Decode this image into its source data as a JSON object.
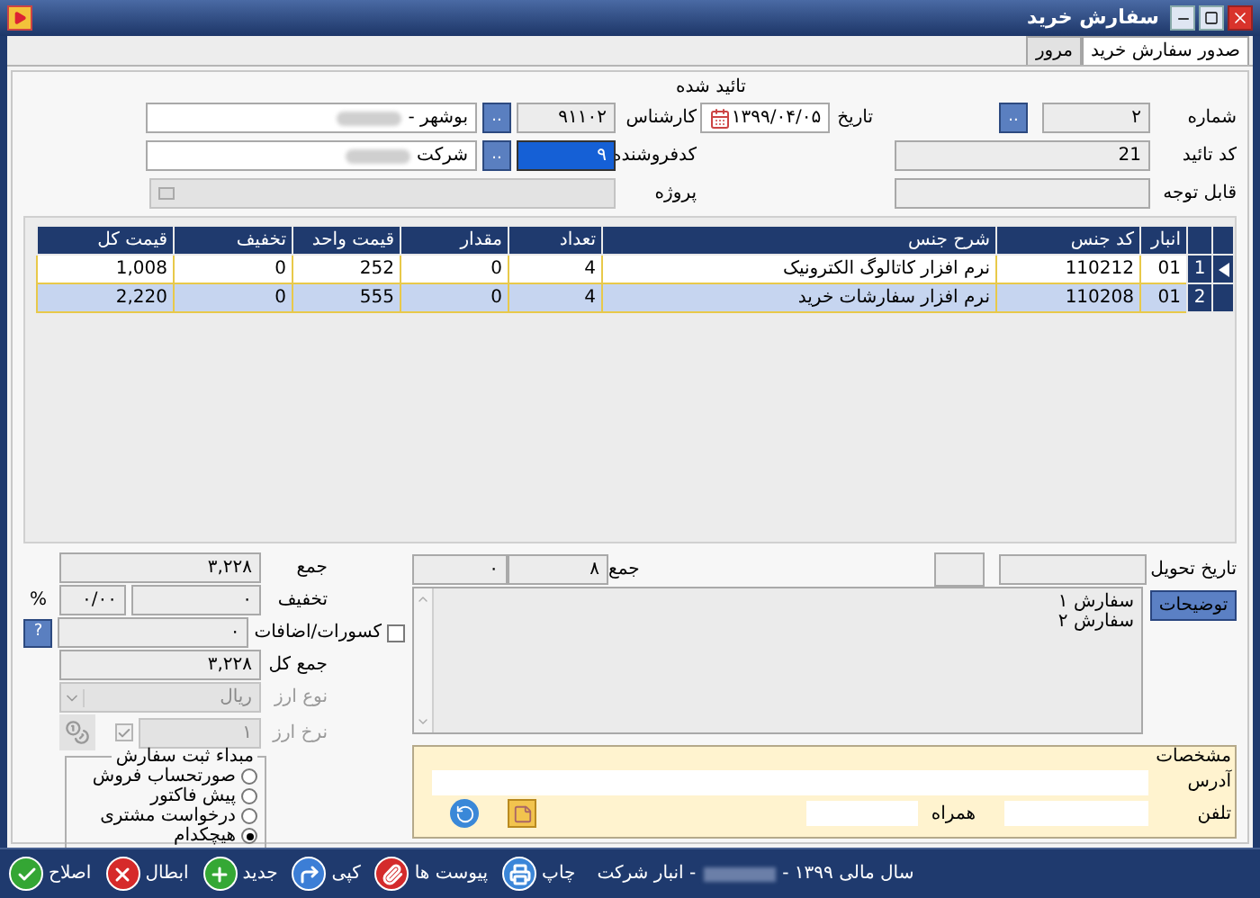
{
  "window": {
    "title": "سفارش خرید"
  },
  "tabs": [
    {
      "label": "صدور سفارش خرید",
      "selected": true
    },
    {
      "label": "مرور",
      "selected": false
    }
  ],
  "header": {
    "status": "تائید شده",
    "number": {
      "label": "شماره",
      "value": "۲",
      "button": ".."
    },
    "date": {
      "label": "تاریخ",
      "value": "۱۳۹۹/۰۴/۰۵"
    },
    "expert": {
      "label": "کارشناس",
      "code": "۹۱۱۰۲",
      "button": "..",
      "name": "بوشهر -"
    },
    "approval_code": {
      "label": "کد تائید",
      "value": "21"
    },
    "seller": {
      "label": "کدفروشنده",
      "code": "۹",
      "highlighted": true,
      "button": "..",
      "name": "شرکت"
    },
    "attention": {
      "label": "قابل توجه"
    },
    "project": {
      "label": "پروژه",
      "disabled": true
    }
  },
  "table": {
    "columns": [
      "انبار",
      "کد جنس",
      "شرح جنس",
      "تعداد",
      "مقدار",
      "قیمت واحد",
      "تخفیف",
      "قیمت کل"
    ],
    "rows": [
      {
        "number": "1",
        "current": true,
        "selected": false,
        "cells": [
          "01",
          "110212",
          "نرم افزار کاتالوگ الکترونیک",
          "4",
          "0",
          "252",
          "0",
          "1,008"
        ]
      },
      {
        "number": "2",
        "current": false,
        "selected": true,
        "cells": [
          "01",
          "110208",
          "نرم افزار سفارشات خرید",
          "4",
          "0",
          "555",
          "0",
          "2,220"
        ]
      }
    ]
  },
  "delivery": {
    "label": "تاریخ تحویل"
  },
  "quantity_sum": {
    "label": "جمع",
    "count": "۸",
    "amount": "۰"
  },
  "notes": {
    "button": "توضیحات",
    "lines": [
      "سفارش ۱",
      "سفارش ۲"
    ]
  },
  "details": {
    "title": "مشخصات",
    "address_label": "آدرس",
    "phone_label": "تلفن",
    "mobile_label": "همراه"
  },
  "summary": {
    "total": {
      "label": "جمع",
      "value": "۳,۲۲۸"
    },
    "discount": {
      "label": "تخفیف",
      "value": "۰",
      "percent": "۰/۰۰",
      "percent_sign": "%"
    },
    "deductions": {
      "label": "کسورات/اضافات",
      "value": "۰",
      "checked": false,
      "help": "?"
    },
    "grand_total": {
      "label": "جمع کل",
      "value": "۳,۲۲۸"
    },
    "currency": {
      "label": "نوع ارز",
      "value": "ریال",
      "disabled": true
    },
    "rate": {
      "label": "نرخ ارز",
      "value": "۱",
      "checked": true,
      "disabled": true
    }
  },
  "order_source": {
    "title": "مبداء ثبت سفارش",
    "options": [
      {
        "label": "صورتحساب فروش",
        "selected": false
      },
      {
        "label": "پیش فاکتور",
        "selected": false
      },
      {
        "label": "درخواست مشتری",
        "selected": false
      },
      {
        "label": "هیچکدام",
        "selected": true
      }
    ]
  },
  "toolbar": [
    {
      "kind": "print",
      "label": "چاپ"
    },
    {
      "kind": "attach",
      "label": "پیوست ها"
    },
    {
      "kind": "copy",
      "label": "کپی"
    },
    {
      "kind": "new",
      "label": "جدید"
    },
    {
      "kind": "cancel",
      "label": "ابطال"
    },
    {
      "kind": "edit",
      "label": "اصلاح"
    }
  ],
  "status": {
    "fiscal_year": "سال مالی ۱۳۹۹ -",
    "warehouse": "- انبار شرکت"
  }
}
